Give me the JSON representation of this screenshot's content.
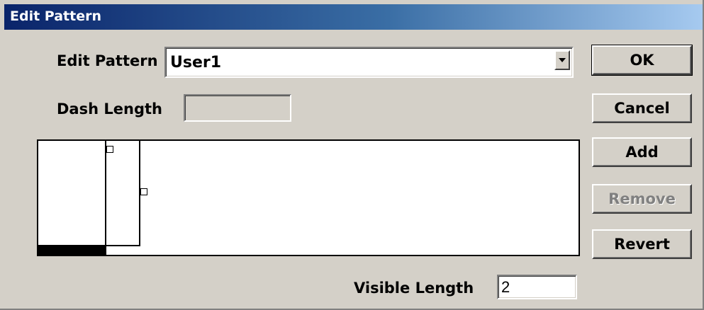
{
  "window": {
    "title": "Edit Pattern"
  },
  "fields": {
    "edit_pattern_label": "Edit Pattern",
    "edit_pattern_value": "User1",
    "dash_length_label": "Dash Length",
    "dash_length_value": "",
    "visible_length_label": "Visible Length",
    "visible_length_value": "2"
  },
  "buttons": {
    "ok": "OK",
    "cancel": "Cancel",
    "add": "Add",
    "remove": "Remove",
    "revert": "Revert"
  },
  "pattern_editor": {
    "segments": [
      "dash",
      "gap"
    ],
    "remove_enabled": false
  },
  "colors": {
    "titlebar_start": "#0a246a",
    "titlebar_end": "#a6caf0",
    "dialog_bg": "#d4d0c8"
  }
}
